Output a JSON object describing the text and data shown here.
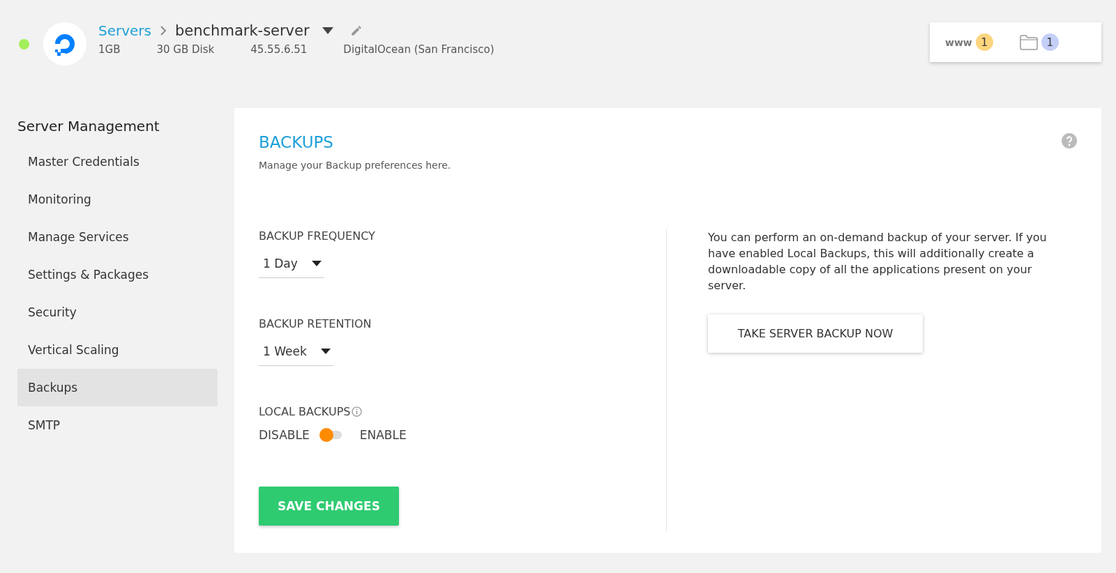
{
  "server": {
    "online": true,
    "breadcrumb": "Servers",
    "name": "benchmark-server",
    "specs": [
      "1GB",
      "30 GB Disk",
      "45.55.6.51",
      "DigitalOcean (San Francisco)"
    ]
  },
  "counters": [
    {
      "kind": "text",
      "label": "www",
      "count": "1",
      "color": "#fdd57e"
    },
    {
      "kind": "folder",
      "count": "1",
      "color": "#c4cff8"
    }
  ],
  "sidebar": {
    "title": "Server Management",
    "items": [
      {
        "label": "Master Credentials",
        "selected": false
      },
      {
        "label": "Monitoring",
        "selected": false
      },
      {
        "label": "Manage Services",
        "selected": false
      },
      {
        "label": "Settings & Packages",
        "selected": false
      },
      {
        "label": "Security",
        "selected": false
      },
      {
        "label": "Vertical Scaling",
        "selected": false
      },
      {
        "label": "Backups",
        "selected": true
      },
      {
        "label": "SMTP",
        "selected": false
      }
    ]
  },
  "panel": {
    "title": "BACKUPS",
    "subtitle": "Manage your Backup preferences here.",
    "frequency": {
      "label": "BACKUP FREQUENCY",
      "value": "1 Day"
    },
    "retention": {
      "label": "BACKUP RETENTION",
      "value": "1 Week"
    },
    "local_backups": {
      "label": "LOCAL BACKUPS",
      "off_label": "DISABLE",
      "on_label": "ENABLE",
      "on": false
    },
    "save_button": "SAVE CHANGES",
    "info": "You can perform an on-demand backup of your server. If you have enabled Local Backups, this will additionally create a downloadable copy of all the applications present on your server.",
    "backup_button": "TAKE SERVER BACKUP NOW"
  }
}
